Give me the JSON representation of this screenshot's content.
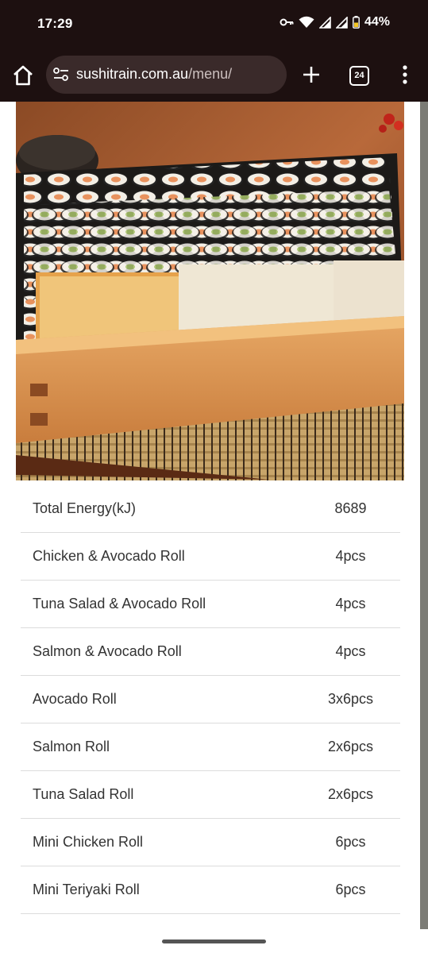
{
  "status_bar": {
    "time": "17:29",
    "battery_percent": "44%"
  },
  "browser": {
    "url_domain": "sushitrain.com.au",
    "url_path": "/menu/",
    "tab_count": "24"
  },
  "menu_items": [
    {
      "name": "Total Energy(kJ)",
      "qty": "8689"
    },
    {
      "name": "Chicken & Avocado Roll",
      "qty": "4pcs"
    },
    {
      "name": "Tuna Salad & Avocado Roll",
      "qty": "4pcs"
    },
    {
      "name": "Salmon & Avocado Roll",
      "qty": "4pcs"
    },
    {
      "name": "Avocado Roll",
      "qty": "3x6pcs"
    },
    {
      "name": "Salmon Roll",
      "qty": "2x6pcs"
    },
    {
      "name": "Tuna Salad Roll",
      "qty": "2x6pcs"
    },
    {
      "name": "Mini Chicken Roll",
      "qty": "6pcs"
    },
    {
      "name": "Mini Teriyaki Roll",
      "qty": "6pcs"
    }
  ],
  "colors": {
    "browser_chrome": "#1d1010",
    "url_bar": "#3a2a2a",
    "table_text": "#333333",
    "divider": "#dcdcdc"
  },
  "icons": [
    "key-icon",
    "wifi-icon",
    "signal-icon",
    "battery-icon",
    "home-icon",
    "site-settings-icon",
    "plus-icon",
    "tab-switcher-icon",
    "overflow-menu-icon"
  ]
}
